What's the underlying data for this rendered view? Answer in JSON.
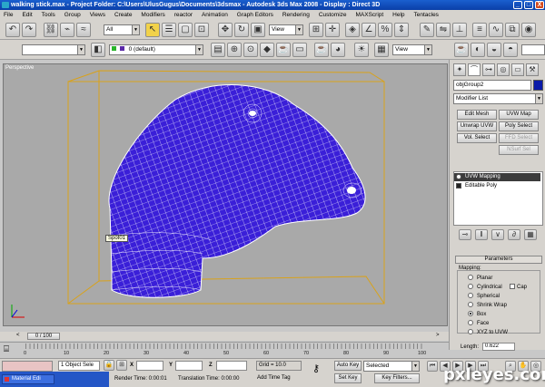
{
  "window": {
    "title": "walking stick.max    - Project Folder: C:\\Users\\UlusGugus\\Documents\\3dsmax    - Autodesk 3ds Max 2008    - Display : Direct 3D",
    "buttons": [
      "_",
      "□",
      "X"
    ]
  },
  "menu": [
    "File",
    "Edit",
    "Tools",
    "Group",
    "Views",
    "Create",
    "Modifiers",
    "reactor",
    "Animation",
    "Graph Editors",
    "Rendering",
    "Customize",
    "MAXScript",
    "Help",
    "Tentacles"
  ],
  "toolbar": {
    "selection_filter": "All",
    "reference_coord": "View",
    "layer": "0 (default)",
    "view_combo": "View"
  },
  "viewport": {
    "label": "Perspective",
    "tooltip": "Spot01"
  },
  "command_panel": {
    "object_name": "objGroup2",
    "modifier_list": "Modifier List",
    "modifier_buttons": [
      "Edit Mesh",
      "UVW Map",
      "Unwrap UVW",
      "Poly Select",
      "Vol. Select",
      "FFD Select",
      "NSurf Sel"
    ],
    "stack": [
      "UVW Mapping",
      "Editable Poly"
    ],
    "rollout_title": "Parameters",
    "mapping_label": "Mapping:",
    "mapping_options": [
      "Planar",
      "Cylindrical",
      "Spherical",
      "Shrink Wrap",
      "Box",
      "Face",
      "XYZ to UVW"
    ],
    "selected_mapping": "Box",
    "cap_label": "Cap",
    "length_label": "Length:",
    "length_value": "0.622"
  },
  "timeline": {
    "frame_display": "0 / 100",
    "ticks": [
      "0",
      "10",
      "20",
      "30",
      "40",
      "50",
      "60",
      "70",
      "80",
      "90",
      "100"
    ]
  },
  "status": {
    "selection": "1 Object Sele",
    "x_label": "X",
    "y_label": "Y",
    "z_label": "Z",
    "grid": "Grid = 10.0",
    "auto_key": "Auto Key",
    "key_mode": "Selected",
    "set_key": "Set Key",
    "key_filters": "Key Filters...",
    "render_time": "Render Time: 0:00:01",
    "translation_time": "Translation Time: 0:00:00",
    "add_time_tag": "Add Time Tag",
    "taskbar_item": "Material Edi"
  },
  "watermark": "pxleyes.com",
  "colors": {
    "mesh": "#3a1fd8",
    "wire": "#ffffff",
    "bbox": "#d9a21a",
    "viewport_bg": "#a9a9a9"
  }
}
